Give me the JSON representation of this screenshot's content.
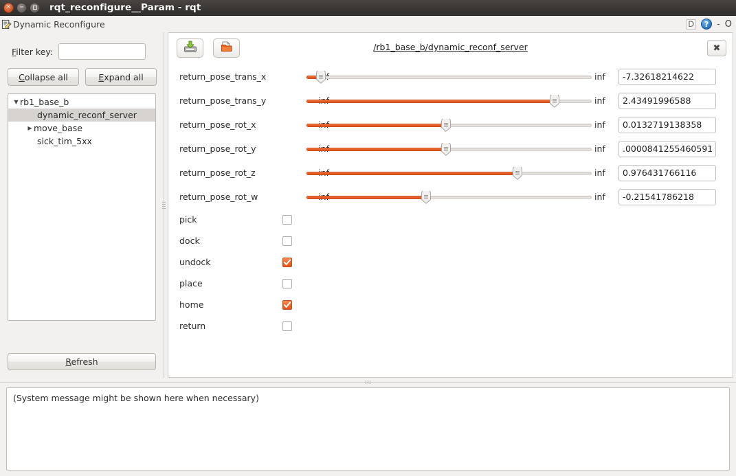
{
  "window": {
    "title": "rqt_reconfigure__Param - rqt",
    "controls": {
      "close": "close-button",
      "minimize": "minimize-button",
      "maximize": "maximize-button"
    }
  },
  "dock": {
    "title": "Dynamic Reconfigure",
    "icon": "document-pencil-icon",
    "key_badge": "D",
    "help": "?",
    "minimize_glyph": "-",
    "float_glyph": "O"
  },
  "sidebar": {
    "filter_label_prefix": "F",
    "filter_label_rest": "ilter key:",
    "filter_value": "",
    "filter_placeholder": "",
    "collapse_prefix": "C",
    "collapse_rest": "ollapse all",
    "expand_prefix": "E",
    "expand_rest": "xpand all",
    "tree": [
      {
        "label": "rb1_base_b",
        "arrow": "▼",
        "indent": 6,
        "selected": false
      },
      {
        "label": "dynamic_reconf_server",
        "arrow": "",
        "indent": 42,
        "selected": true
      },
      {
        "label": "move_base",
        "arrow": "▶",
        "indent": 26,
        "selected": false
      },
      {
        "label": "sick_tim_5xx",
        "arrow": "",
        "indent": 42,
        "selected": false
      }
    ],
    "refresh_prefix": "R",
    "refresh_rest": "efresh"
  },
  "panel": {
    "save_icon": "save-disk-icon",
    "open_icon": "open-folder-icon",
    "link": "/rb1_base_b/dynamic_reconf_server",
    "close_glyph": "✖"
  },
  "params": [
    {
      "name": "return_pose_trans_x",
      "min": "-inf",
      "max": "inf",
      "value": "-7.32618214622",
      "pos": 5
    },
    {
      "name": "return_pose_trans_y",
      "min": "-inf",
      "max": "inf",
      "value": "2.43491996588",
      "pos": 87
    },
    {
      "name": "return_pose_rot_x",
      "min": "-inf",
      "max": "inf",
      "value": "0.0132719138358",
      "pos": 49
    },
    {
      "name": "return_pose_rot_y",
      "min": "-inf",
      "max": "inf",
      "value": ".0000841255460591",
      "pos": 49
    },
    {
      "name": "return_pose_rot_z",
      "min": "-inf",
      "max": "inf",
      "value": "0.976431766116",
      "pos": 74
    },
    {
      "name": "return_pose_rot_w",
      "min": "-inf",
      "max": "inf",
      "value": "-0.21541786218",
      "pos": 42
    }
  ],
  "booleans": [
    {
      "name": "pick",
      "checked": false
    },
    {
      "name": "dock",
      "checked": false
    },
    {
      "name": "undock",
      "checked": true
    },
    {
      "name": "place",
      "checked": false
    },
    {
      "name": "home",
      "checked": true
    },
    {
      "name": "return",
      "checked": false
    }
  ],
  "status": {
    "message": "(System message might be shown here when necessary)"
  },
  "colors": {
    "accent_orange": "#e85f28",
    "titlebar": "#3b3735",
    "panel_bg": "#f2f1f0",
    "selection": "#d6d3d0"
  }
}
